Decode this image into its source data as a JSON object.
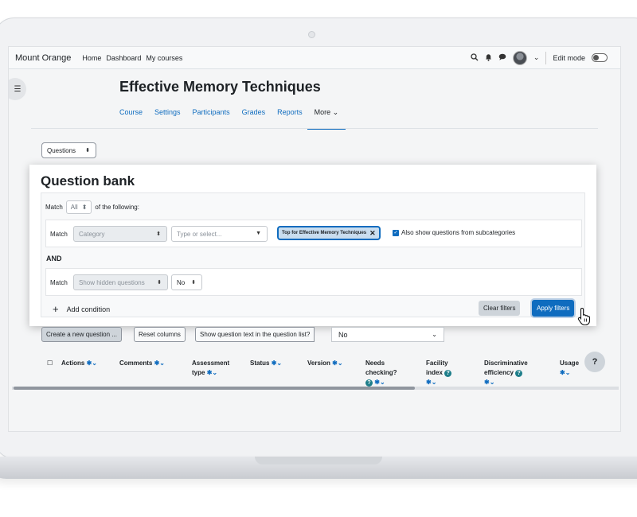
{
  "navbar": {
    "brand": "Mount Orange",
    "links": [
      "Home",
      "Dashboard",
      "My courses"
    ],
    "edit_mode_label": "Edit mode"
  },
  "course": {
    "title": "Effective Memory Techniques",
    "tabs": [
      {
        "label": "Course",
        "active": false
      },
      {
        "label": "Settings",
        "active": false
      },
      {
        "label": "Participants",
        "active": false
      },
      {
        "label": "Grades",
        "active": false
      },
      {
        "label": "Reports",
        "active": false
      },
      {
        "label": "More ⌄",
        "active": true
      }
    ]
  },
  "page_selector": {
    "value": "Questions",
    "caret": "⬍"
  },
  "question_bank": {
    "title": "Question bank",
    "match_prefix": "Match",
    "match_value": "All",
    "match_suffix": "of the following:",
    "condition1": {
      "label": "Match",
      "field": "Category",
      "type_placeholder": "Type or select...",
      "chip": "Top for Effective Memory Techniques",
      "chip_remove": "✕",
      "checkbox_label": "Also show questions from subcategories",
      "checkbox_checked": true
    },
    "and_label": "AND",
    "condition2": {
      "label": "Match",
      "field": "Show hidden questions",
      "value": "No"
    },
    "add_condition": "Add condition",
    "clear_filters": "Clear filters",
    "apply_filters": "Apply filters"
  },
  "toolbar": {
    "create_button": "Create a new question ...",
    "reset_columns": "Reset columns",
    "show_text_label": "Show question text in the question list?",
    "show_text_value": "No"
  },
  "table": {
    "headers": {
      "actions": "Actions",
      "comments": "Comments",
      "assessment_type_1": "Assessment",
      "assessment_type_2": "type",
      "status": "Status",
      "version": "Version",
      "needs_checking_1": "Needs",
      "needs_checking_2": "checking?",
      "facility_1": "Facility",
      "facility_2": "index",
      "disc_1": "Discriminative",
      "disc_2": "efficiency",
      "usage": "Usage"
    }
  },
  "help_button": "?",
  "colors": {
    "accent": "#0f6cbf",
    "info": "#1e7e8a"
  },
  "icons": [
    "drawer-icon",
    "search-icon",
    "bell-icon",
    "chat-icon",
    "gear-icon",
    "info-icon",
    "plus-icon",
    "pointer-cursor-icon"
  ]
}
